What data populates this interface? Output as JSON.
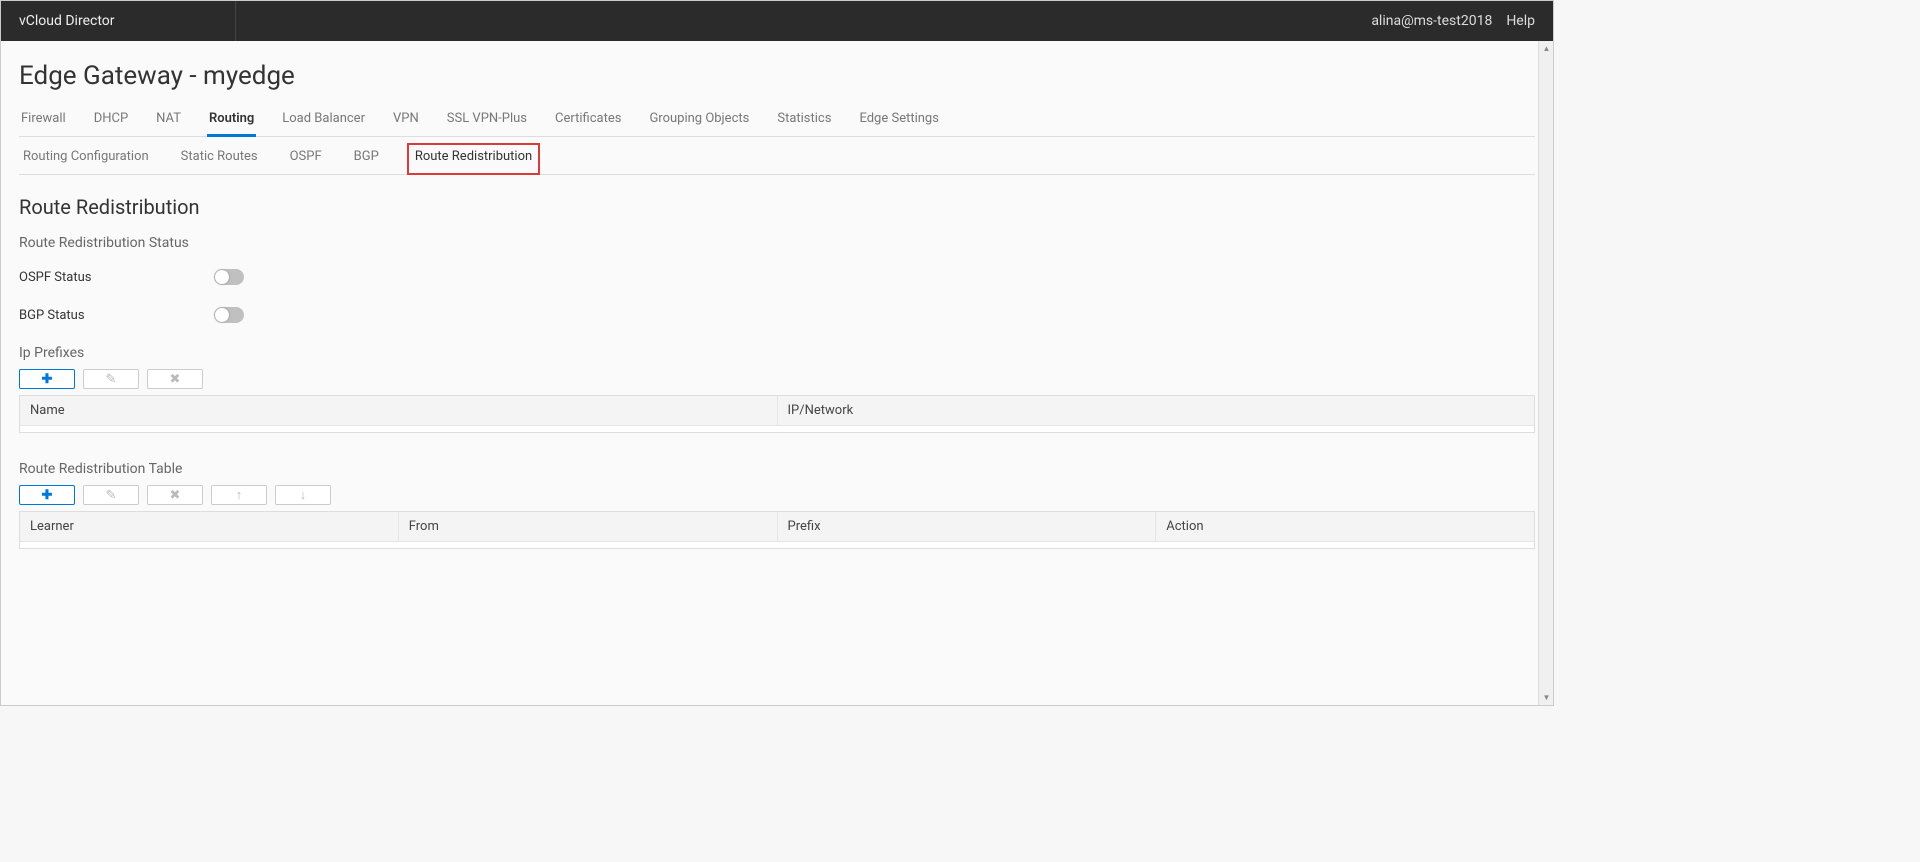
{
  "header": {
    "app_name": "vCloud Director",
    "user": "alina@ms-test2018",
    "help": "Help"
  },
  "page": {
    "title": "Edge Gateway - myedge"
  },
  "tabs": {
    "items": [
      {
        "label": "Firewall"
      },
      {
        "label": "DHCP"
      },
      {
        "label": "NAT"
      },
      {
        "label": "Routing",
        "active": true
      },
      {
        "label": "Load Balancer"
      },
      {
        "label": "VPN"
      },
      {
        "label": "SSL VPN-Plus"
      },
      {
        "label": "Certificates"
      },
      {
        "label": "Grouping Objects"
      },
      {
        "label": "Statistics"
      },
      {
        "label": "Edge Settings"
      }
    ]
  },
  "subtabs": {
    "items": [
      {
        "label": "Routing Configuration"
      },
      {
        "label": "Static Routes"
      },
      {
        "label": "OSPF"
      },
      {
        "label": "BGP"
      },
      {
        "label": "Route Redistribution",
        "active": true
      }
    ]
  },
  "sections": {
    "main_title": "Route Redistribution",
    "status_title": "Route Redistribution Status",
    "ospf_label": "OSPF Status",
    "bgp_label": "BGP Status",
    "ip_prefixes_title": "Ip Prefixes",
    "route_table_title": "Route Redistribution Table"
  },
  "ip_prefix_grid": {
    "columns": [
      {
        "label": "Name"
      },
      {
        "label": "IP/Network"
      }
    ]
  },
  "route_table_grid": {
    "columns": [
      {
        "label": "Learner"
      },
      {
        "label": "From"
      },
      {
        "label": "Prefix"
      },
      {
        "label": "Action"
      }
    ]
  },
  "icons": {
    "plus": "✚",
    "edit": "✎",
    "delete": "✖",
    "up": "↑",
    "down": "↓",
    "arrow_up": "▲",
    "arrow_down": "▼"
  }
}
